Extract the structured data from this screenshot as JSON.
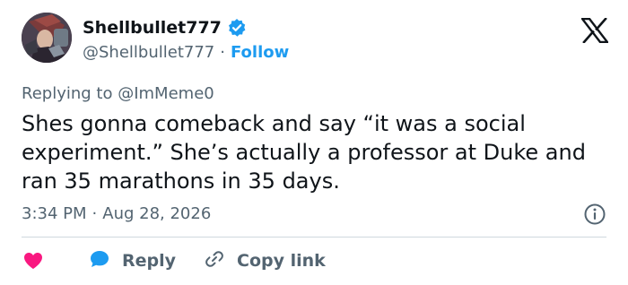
{
  "user": {
    "display_name": "Shellbullet777",
    "handle": "@Shellbullet777",
    "separator": "·",
    "follow_label": "Follow"
  },
  "reply_context": {
    "prefix": "Replying to",
    "mention": "@ImMeme0"
  },
  "tweet": {
    "text": "Shes gonna comeback and say “it was a social experiment.” She’s actually a professor at Duke and ran 35 marathons in 35 days.",
    "time": "3:34 PM",
    "separator": "·",
    "date": "Aug 28, 2026"
  },
  "actions": {
    "reply_label": "Reply",
    "copy_link_label": "Copy link"
  },
  "icons": {
    "verified": "verified-badge-icon",
    "platform": "x-logo-icon",
    "info": "info-icon",
    "like": "heart-icon",
    "reply": "speech-bubble-icon",
    "copy_link": "link-icon"
  },
  "colors": {
    "accent": "#1d9bf0",
    "like": "#f91880",
    "text": "#0f1419",
    "secondary_text": "#536471",
    "divider": "#cfd9de"
  }
}
